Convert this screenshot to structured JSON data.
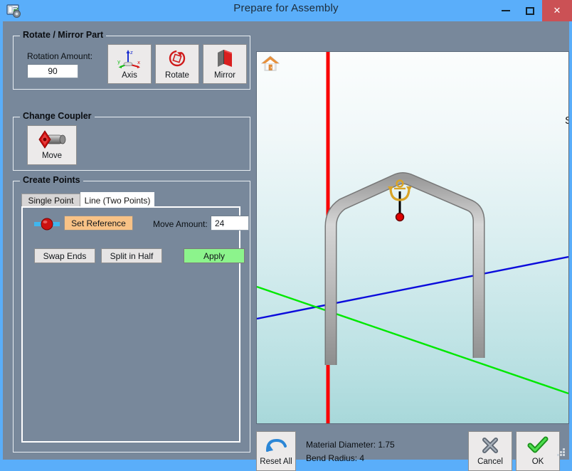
{
  "window": {
    "title": "Prepare for Assembly",
    "icon": "window-gear-icon",
    "controls": {
      "minimize": "minimize-icon",
      "maximize": "maximize-icon",
      "close": "✕"
    },
    "colors": {
      "titlebar": "#5aaefa",
      "client": "#78889b",
      "close_button": "#cb5155",
      "apply_button": "#8cf48c",
      "reference_button": "#f8c286"
    }
  },
  "rotate_mirror_part": {
    "legend": "Rotate / Mirror Part",
    "rotation_amount_label": "Rotation Amount:",
    "rotation_amount_value": "90",
    "rotation_amount_placeholder": "",
    "buttons": [
      {
        "label": "Axis",
        "icon": "axis-triad-icon"
      },
      {
        "label": "Rotate",
        "icon": "rotate-arrow-icon"
      },
      {
        "label": "Mirror",
        "icon": "mirror-planes-icon"
      }
    ]
  },
  "change_coupler": {
    "legend": "Change Coupler",
    "buttons": [
      {
        "label": "Move",
        "icon": "coupler-move-icon"
      }
    ]
  },
  "create_points": {
    "legend": "Create Points",
    "tabs": [
      {
        "label": "Single Point",
        "selected": false
      },
      {
        "label": "Line (Two Points)",
        "selected": true
      }
    ],
    "reference_icon": "line-two-points-icon",
    "set_reference_label": "Set Reference",
    "move_amount_label": "Move Amount:",
    "move_amount_value": "24",
    "move_amount_placeholder": "",
    "swap_ends_label": "Swap Ends",
    "split_in_half_label": "Split in Half",
    "apply_label": "Apply"
  },
  "viewport": {
    "home_icon": "home-view-icon",
    "clipped_label": "S",
    "model": {
      "description": "bent tube roll hoop",
      "tube_color": "#b5b5b5",
      "axes": {
        "x_color": "#00e800",
        "y_color": "#0000e8",
        "z_color": "#fa0000"
      },
      "anchor_icon": "anchor-icon",
      "anchor_point_color": "#e00000"
    }
  },
  "footer": {
    "reset_all_label": "Reset All",
    "reset_all_icon": "undo-arrow-icon",
    "material_diameter_label": "Material Diameter: 1.75",
    "bend_radius_label": "Bend Radius: 4",
    "cancel_label": "Cancel",
    "cancel_icon": "x-mark-icon",
    "ok_label": "OK",
    "ok_icon": "check-mark-icon",
    "resize_grip": "resize-grip-icon"
  }
}
